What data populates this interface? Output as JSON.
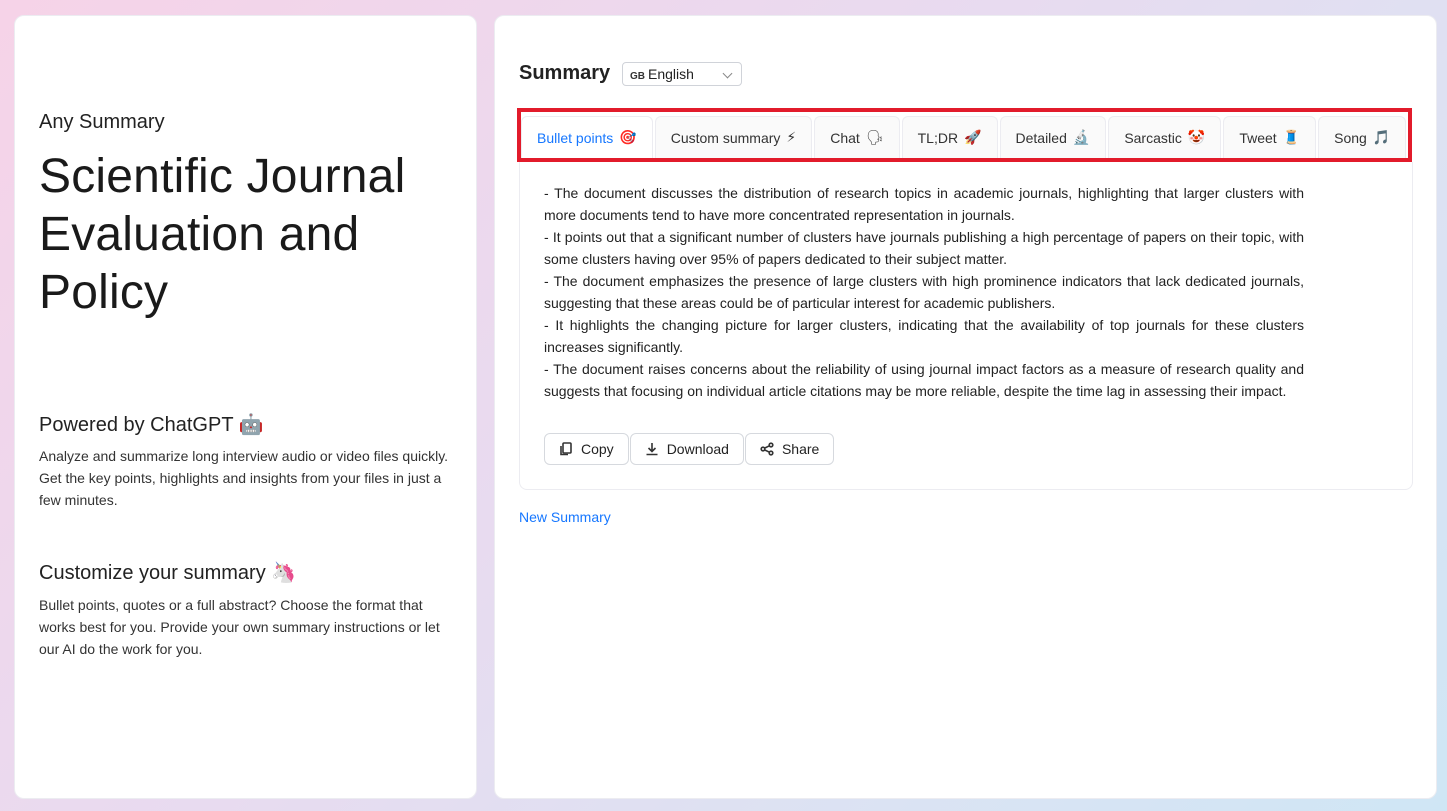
{
  "left": {
    "app_name": "Any Summary",
    "doc_title": "Scientific Journal Evaluation and Policy",
    "powered_heading": "Powered by ChatGPT 🤖",
    "powered_text": "Analyze and summarize long interview audio or video files quickly. Get the key points, highlights and insights from your files in just a few minutes.",
    "customize_heading": "Customize your summary 🦄",
    "customize_text": "Bullet points, quotes or a full abstract? Choose the format that works best for you. Provide your own summary instructions or let our AI do the work for you."
  },
  "header": {
    "summary_label": "Summary",
    "language_flag": "GB",
    "language": "English"
  },
  "tabs": [
    {
      "label": "Bullet points",
      "emoji": "🎯"
    },
    {
      "label": "Custom summary",
      "emoji": "⚡"
    },
    {
      "label": "Chat",
      "emoji": "🗣"
    },
    {
      "label": "TL;DR",
      "emoji": "🚀"
    },
    {
      "label": "Detailed",
      "emoji": "🔬"
    },
    {
      "label": "Sarcastic",
      "emoji": "🤡"
    },
    {
      "label": "Tweet",
      "emoji": "🧵"
    },
    {
      "label": "Song",
      "emoji": "🎵"
    }
  ],
  "active_tab": "Bullet points",
  "summary": {
    "lines": [
      "- The document discusses the distribution of research topics in academic journals, highlighting that larger clusters with more documents tend to have more concentrated representation in journals.",
      "- It points out that a significant number of clusters have journals publishing a high percentage of papers on their topic, with some clusters having over 95% of papers dedicated to their subject matter.",
      "- The document emphasizes the presence of large clusters with high prominence indicators that lack dedicated journals, suggesting that these areas could be of particular interest for academic publishers.",
      "- It highlights the changing picture for larger clusters, indicating that the availability of top journals for these clusters increases significantly.",
      "- The document raises concerns about the reliability of using journal impact factors as a measure of research quality and suggests that focusing on individual article citations may be more reliable, despite the time lag in assessing their impact."
    ]
  },
  "actions": {
    "copy": "Copy",
    "download": "Download",
    "share": "Share"
  },
  "new_summary": "New Summary",
  "colors": {
    "accent": "#1677ff",
    "highlight_border": "#e21b2b"
  }
}
